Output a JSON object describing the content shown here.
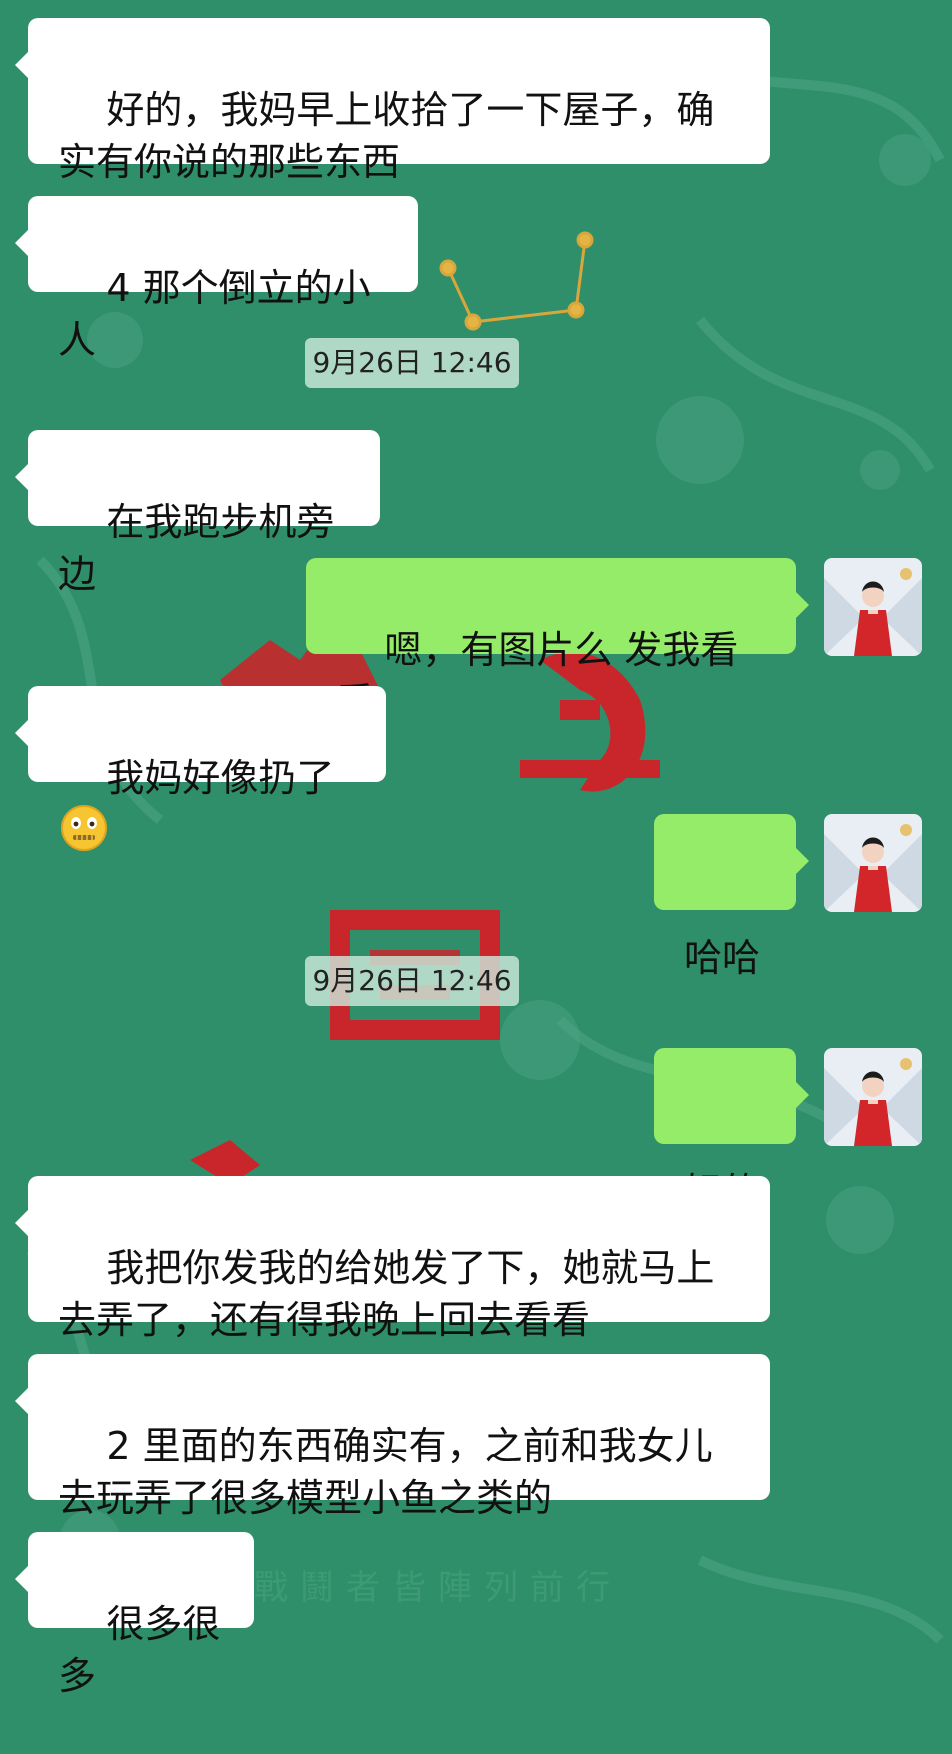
{
  "messages": [
    {
      "side": "left",
      "text": "好的，我妈早上收拾了一下屋子，确实有你说的那些东西"
    },
    {
      "side": "left",
      "text": "4 那个倒立的小人"
    },
    {
      "side": "time",
      "text": "9月26日 12:46"
    },
    {
      "side": "left",
      "text": "在我跑步机旁边"
    },
    {
      "side": "right",
      "text": "嗯，有图片么 发我看看"
    },
    {
      "side": "left",
      "text": "我妈好像扔了",
      "emoji": "zipper-mouth-face-icon"
    },
    {
      "side": "right",
      "text": "哈哈"
    },
    {
      "side": "time",
      "text": "9月26日 12:46"
    },
    {
      "side": "right",
      "text": "好的"
    },
    {
      "side": "left",
      "text": "我把你发我的给她发了下，她就马上去弄了，还有得我晚上回去看看"
    },
    {
      "side": "left",
      "text": "2 里面的东西确实有，之前和我女儿去玩弄了很多模型小鱼之类的"
    },
    {
      "side": "left",
      "text": "很多很多"
    }
  ],
  "background_caption": "戰鬪者皆陣列前行",
  "colors": {
    "chat_bg": "#2f8f6a",
    "sent_bubble": "#95ec69",
    "received_bubble": "#ffffff"
  }
}
